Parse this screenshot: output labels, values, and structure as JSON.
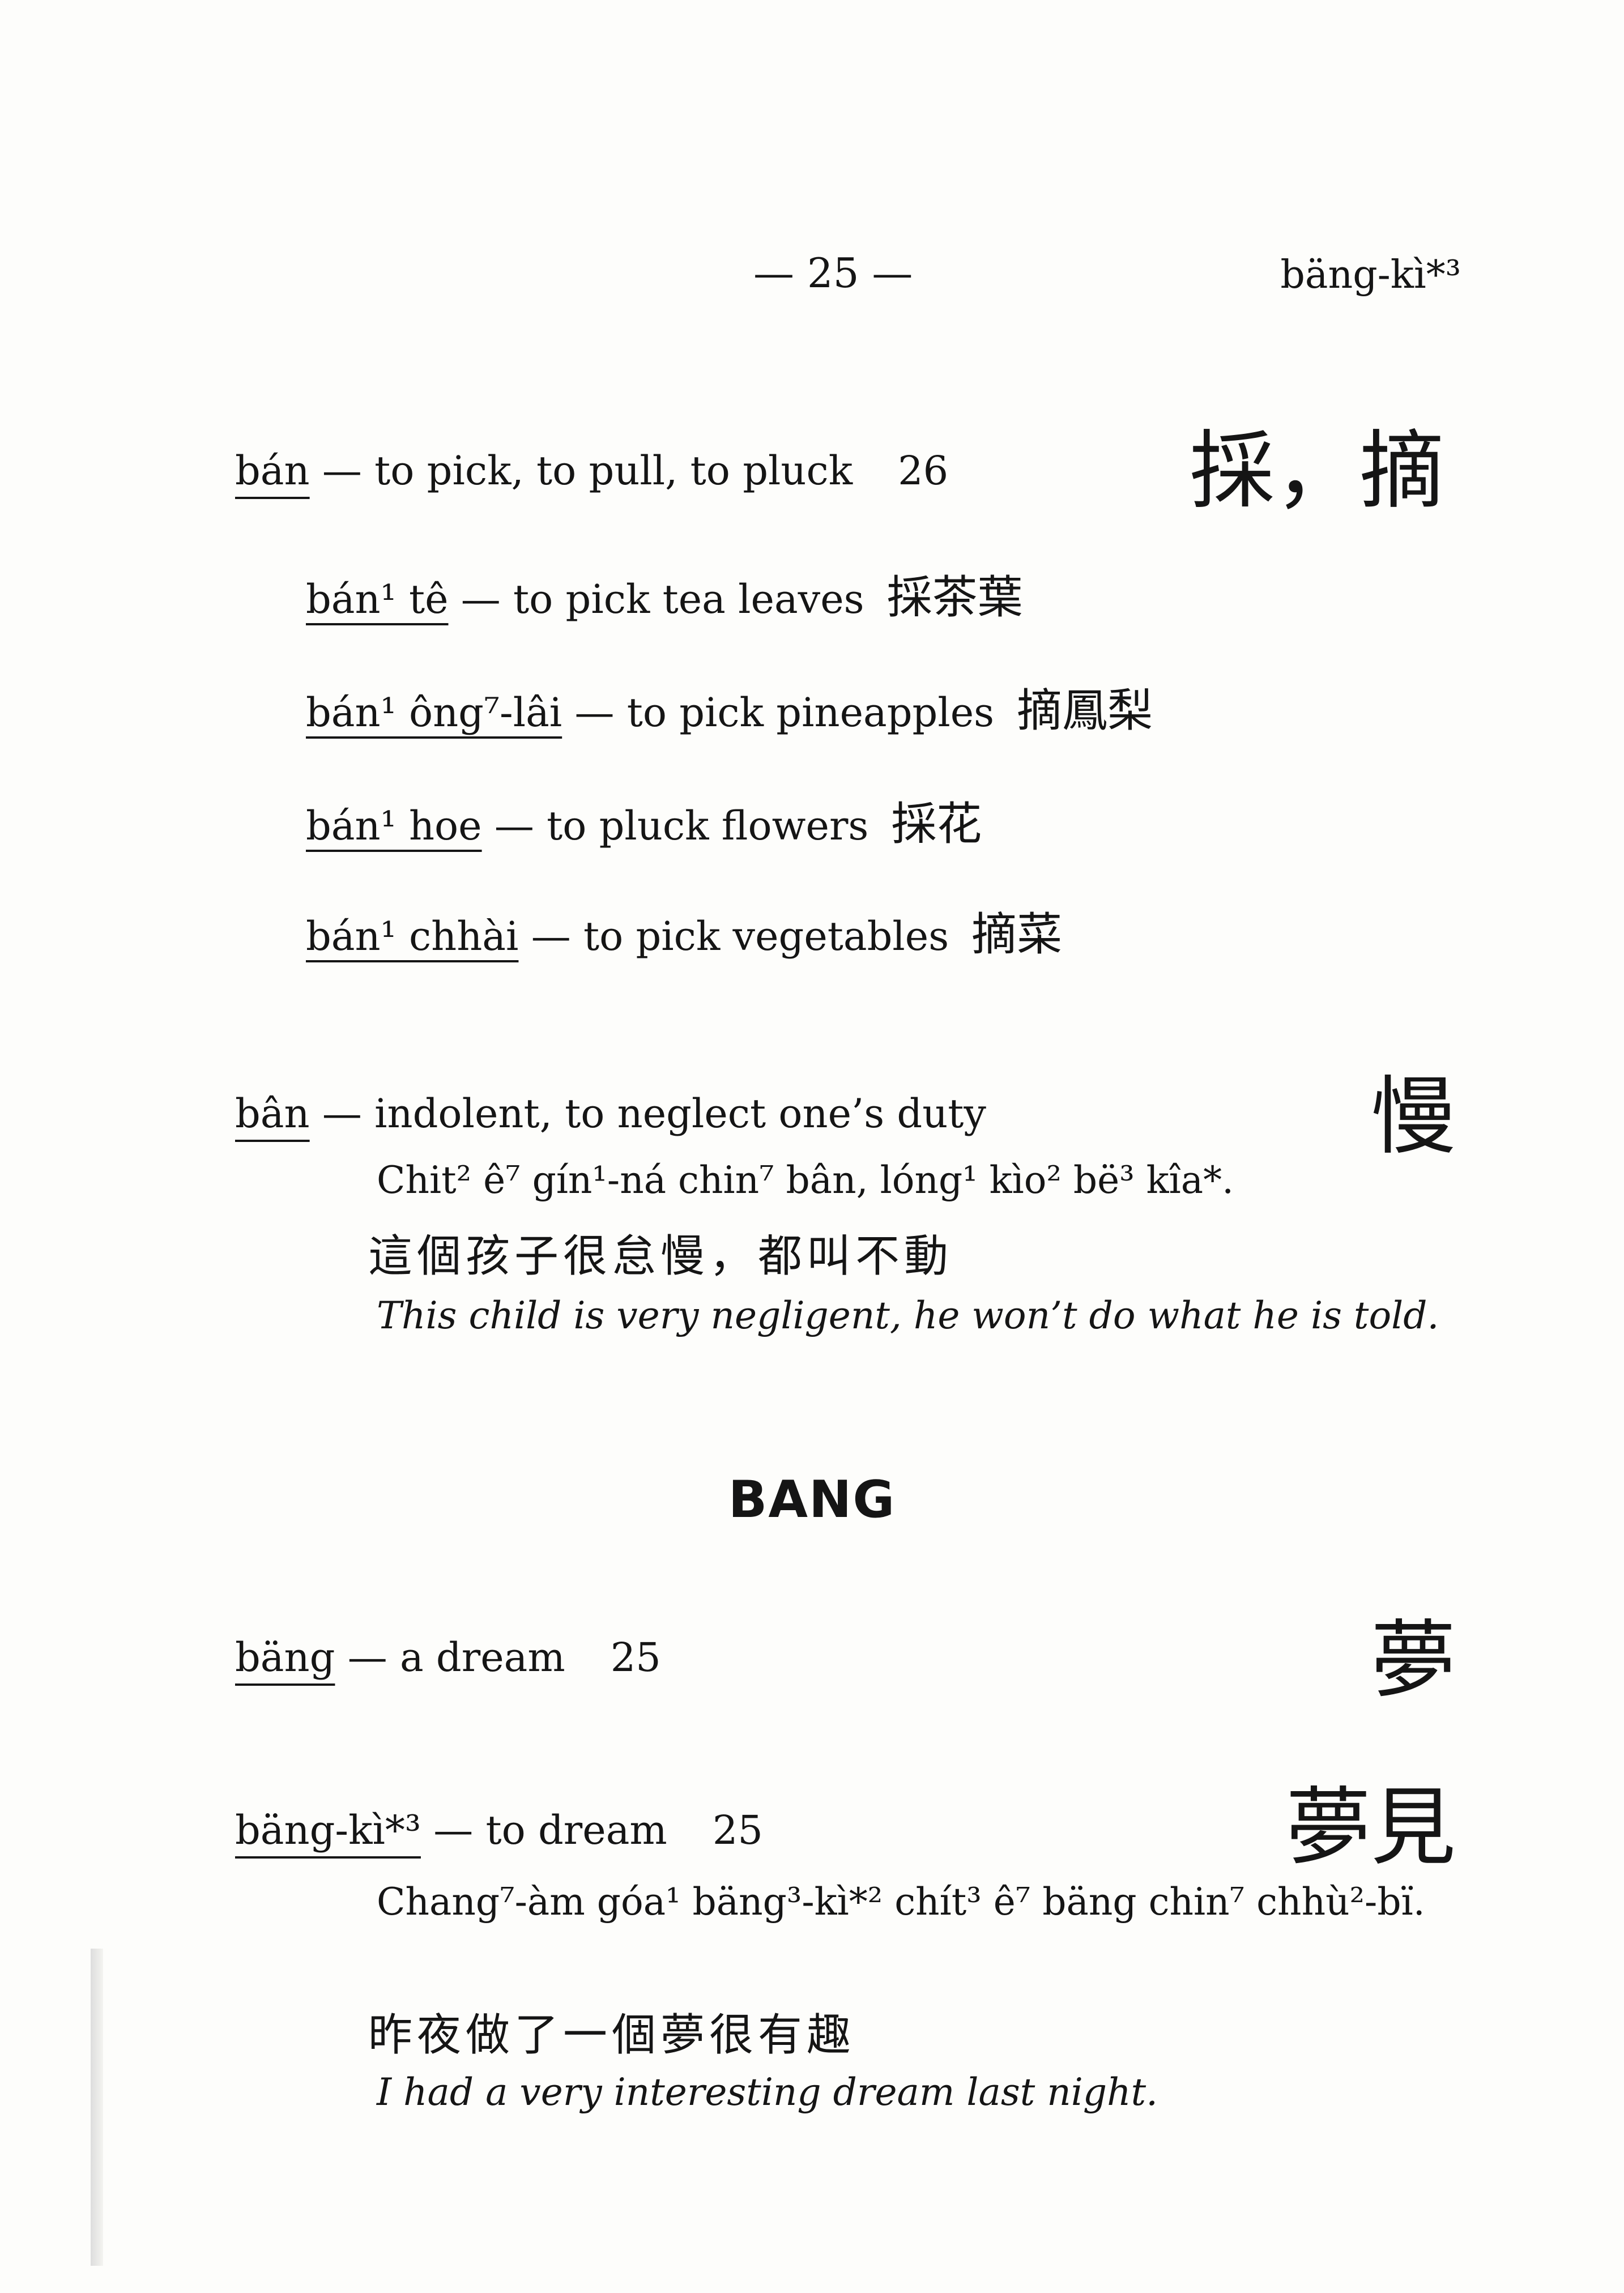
{
  "header": {
    "page_number": "— 25 —",
    "running_head": "bäng-kì*³"
  },
  "entries": [
    {
      "head": "bán",
      "gloss": " — to pick, to pull, to pluck",
      "num": "26",
      "chars": "採，摘",
      "subs": [
        {
          "term": "bán¹ tê",
          "gloss": " — to pick tea leaves",
          "chars": "採茶葉"
        },
        {
          "term": "bán¹ ông⁷-lâi",
          "gloss": " — to pick pineapples",
          "chars": "摘鳳梨"
        },
        {
          "term": "bán¹ hoe",
          "gloss": " — to pluck flowers",
          "chars": "採花"
        },
        {
          "term": "bán¹ chhài",
          "gloss": " — to pick vegetables",
          "chars": "摘菜"
        }
      ]
    },
    {
      "head": "bân",
      "gloss": " — indolent, to neglect one’s duty",
      "chars": "慢",
      "example": "Chit² ê⁷ gín¹-ná chin⁷ bân, lóng¹ kìo² bë³ kîa*.",
      "example_chars": "這個孩子很怠慢，都叫不動",
      "translation": "This child is very negligent, he won’t do what he is told."
    },
    {
      "head": "bäng",
      "gloss": " — a dream",
      "num": "25",
      "chars": "夢"
    },
    {
      "head": "bäng-kì*³",
      "gloss": " — to dream",
      "num": "25",
      "chars": "夢見",
      "example": "Chang⁷-àm góa¹ bäng³-kì*² chít³ ê⁷ bäng chin⁷ chhù²-bï.",
      "example_chars": "昨夜做了一個夢很有趣",
      "translation": "I had a very interesting dream last night."
    }
  ],
  "section_heading": "BANG"
}
